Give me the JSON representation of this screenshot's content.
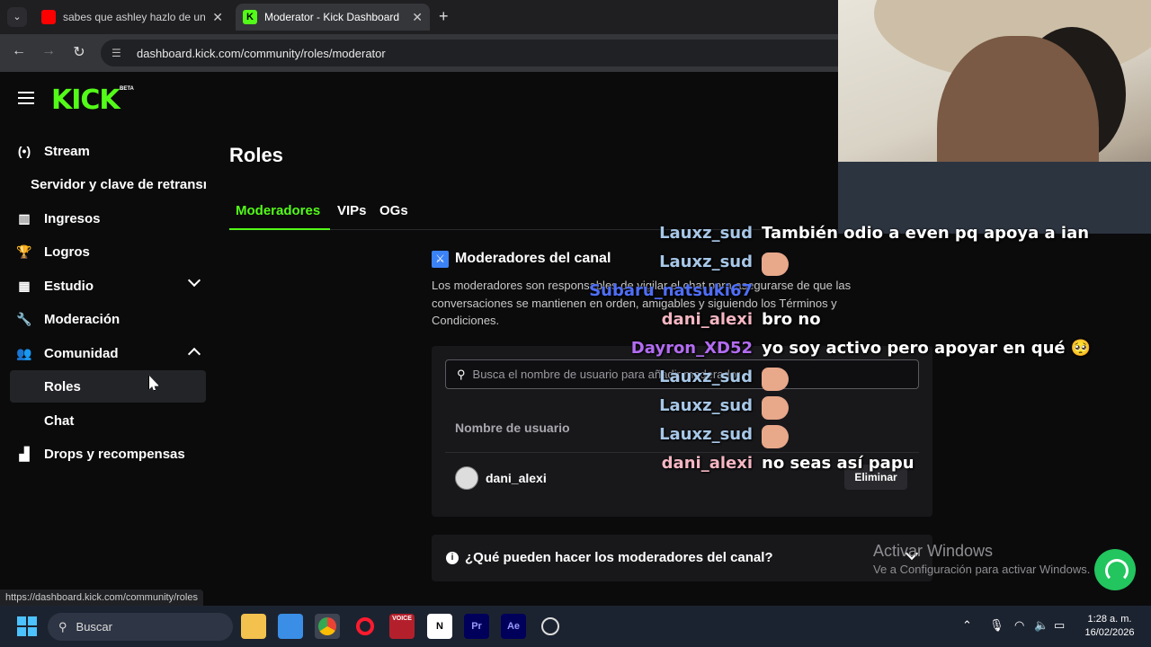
{
  "browser": {
    "tabs": [
      {
        "title": "sabes que ashley hazlo de una v",
        "active": false
      },
      {
        "title": "Moderator - Kick Dashboard",
        "active": true
      }
    ],
    "url": "dashboard.kick.com/community/roles/moderator",
    "status_url": "https://dashboard.kick.com/community/roles"
  },
  "brand": {
    "logo": "KICK",
    "beta": "BETA",
    "accent": "#53fc18"
  },
  "sidebar": {
    "items": [
      {
        "label": "Stream",
        "icon": "broadcast-icon"
      },
      {
        "label": "Servidor y clave de retransm",
        "icon": ""
      },
      {
        "label": "Ingresos",
        "icon": "chart-icon"
      },
      {
        "label": "Logros",
        "icon": "trophy-icon"
      },
      {
        "label": "Estudio",
        "icon": "studio-icon"
      },
      {
        "label": "Moderación",
        "icon": "wrench-icon"
      },
      {
        "label": "Comunidad",
        "icon": "community-icon"
      },
      {
        "label": "Roles",
        "icon": ""
      },
      {
        "label": "Chat",
        "icon": ""
      },
      {
        "label": "Drops y recompensas",
        "icon": "drops-icon"
      }
    ]
  },
  "main": {
    "title": "Roles",
    "tabs": [
      "Moderadores",
      "VIPs",
      "OGs"
    ],
    "section_title": "Moderadores del canal",
    "section_desc": "Los moderadores son responsables de vigilar el chat para asegurarse de que las conversaciones se mantienen en orden, amigables y siguiendo los Términos y Condiciones.",
    "search_placeholder": "Busca el nombre de usuario para añadir moderador",
    "column_header": "Nombre de usuario",
    "moderators": [
      {
        "username": "dani_alexi",
        "action": "Eliminar"
      }
    ],
    "faq": "¿Qué pueden hacer los moderadores del canal?"
  },
  "watermark": {
    "line1": "Activar Windows",
    "line2": "Ve a Configuración para activar Windows."
  },
  "chat": [
    {
      "user": "Lauxz_sud",
      "color": "#a7c7e7",
      "msg": "También odio a even pq apoya a ian",
      "emote": false
    },
    {
      "user": "Lauxz_sud",
      "color": "#a7c7e7",
      "msg": "",
      "emote": true
    },
    {
      "user": "Subaru_natsuki67",
      "color": "#4f6ef7",
      "msg": "",
      "emote": false
    },
    {
      "user": "dani_alexi",
      "color": "#f4b6c2",
      "msg": "bro no",
      "emote": false
    },
    {
      "user": "Dayron_XD52",
      "color": "#b36cf2",
      "msg": "yo soy activo pero apoyar en qué 🥺",
      "emote": false
    },
    {
      "user": "Lauxz_sud",
      "color": "#a7c7e7",
      "msg": "",
      "emote": true
    },
    {
      "user": "Lauxz_sud",
      "color": "#a7c7e7",
      "msg": "",
      "emote": true
    },
    {
      "user": "Lauxz_sud",
      "color": "#a7c7e7",
      "msg": "",
      "emote": true
    },
    {
      "user": "dani_alexi",
      "color": "#f4b6c2",
      "msg": "no seas así papu",
      "emote": false
    }
  ],
  "taskbar": {
    "search": "Buscar",
    "time": "1:28 a. m.",
    "date": "16/02/2026",
    "apps": [
      "explorer",
      "store",
      "chrome",
      "opera",
      "voicemeeter",
      "notion",
      "premiere",
      "aftereffects",
      "obs"
    ]
  }
}
